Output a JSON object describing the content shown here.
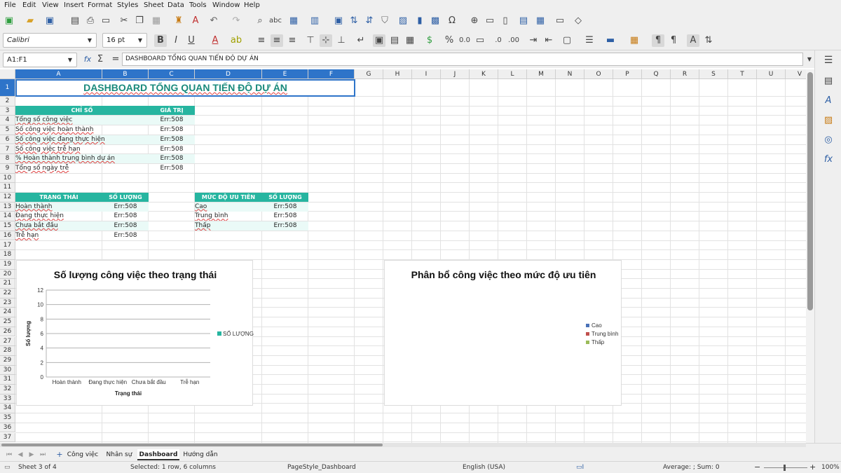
{
  "menu": [
    "File",
    "Edit",
    "View",
    "Insert",
    "Format",
    "Styles",
    "Sheet",
    "Data",
    "Tools",
    "Window",
    "Help"
  ],
  "toolbar": {
    "font_name": "Calibri",
    "font_size": "16 pt"
  },
  "formula_bar": {
    "name_box": "A1:F1",
    "content": "DASHBOARD TỔNG QUAN TIẾN ĐỘ DỰ ÁN"
  },
  "columns": [
    "A",
    "B",
    "C",
    "D",
    "E",
    "F",
    "G",
    "H",
    "I",
    "J",
    "K",
    "L",
    "M",
    "N",
    "O",
    "P",
    "Q",
    "R",
    "S",
    "T",
    "U",
    "V"
  ],
  "rows": [
    "1",
    "2",
    "3",
    "4",
    "5",
    "6",
    "7",
    "8",
    "9",
    "10",
    "11",
    "12",
    "13",
    "14",
    "15",
    "16",
    "17",
    "18",
    "19",
    "20",
    "21",
    "22",
    "23",
    "24",
    "25",
    "26",
    "27",
    "28",
    "29",
    "30",
    "31",
    "32",
    "33",
    "34",
    "35",
    "36",
    "37"
  ],
  "sheet": {
    "title": "DASHBOARD TỔNG QUAN TIẾN ĐỘ DỰ ÁN",
    "kpi_header": {
      "label": "CHỈ SỐ",
      "value": "GIÁ TRỊ"
    },
    "kpis": [
      {
        "label": "Tổng số công việc",
        "value": "Err:508"
      },
      {
        "label": "Số công việc hoàn thành",
        "value": "Err:508"
      },
      {
        "label": "Số công việc đang thực hiện",
        "value": "Err:508"
      },
      {
        "label": "Số công việc trễ hạn",
        "value": "Err:508"
      },
      {
        "label": "% Hoàn thành trung bình dự án",
        "value": "Err:508"
      },
      {
        "label": "Tổng số ngày trễ",
        "value": "Err:508"
      }
    ],
    "status_header": {
      "label": "TRẠNG THÁI",
      "value": "SỐ LƯỢNG"
    },
    "status_rows": [
      {
        "label": "Hoàn thành",
        "value": "Err:508"
      },
      {
        "label": "Đang thực hiện",
        "value": "Err:508"
      },
      {
        "label": "Chưa bắt đầu",
        "value": "Err:508"
      },
      {
        "label": "Trễ hạn",
        "value": "Err:508"
      }
    ],
    "priority_header": {
      "label": "MỨC ĐỘ ƯU TIÊN",
      "value": "SỐ LƯỢNG"
    },
    "priority_rows": [
      {
        "label": "Cao",
        "value": "Err:508"
      },
      {
        "label": "Trung bình",
        "value": "Err:508"
      },
      {
        "label": "Thấp",
        "value": "Err:508"
      }
    ]
  },
  "chart_data": [
    {
      "type": "bar",
      "title": "Số lượng công việc theo trạng thái",
      "categories": [
        "Hoàn thành",
        "Đang thực hiện",
        "Chưa bắt đầu",
        "Trễ hạn"
      ],
      "series": [
        {
          "name": "SỐ LƯỢNG",
          "values": [
            0,
            0,
            0,
            0
          ]
        }
      ],
      "xlabel": "Trạng thái",
      "ylabel": "Số lượng",
      "ylim": [
        0,
        12
      ],
      "yticks": [
        "0",
        "2",
        "4",
        "6",
        "8",
        "10",
        "12"
      ],
      "grid": true,
      "legend": "right",
      "color": "#26b5a0"
    },
    {
      "type": "pie",
      "title": "Phân bổ công việc theo mức độ ưu tiên",
      "categories": [
        "Cao",
        "Trung bình",
        "Thấp"
      ],
      "values": [
        0,
        0,
        0
      ],
      "legend": "right",
      "colors": [
        "#4a72b8",
        "#c0504d",
        "#9bbb59"
      ]
    }
  ],
  "tabs": [
    {
      "label": "Công việc",
      "active": false
    },
    {
      "label": "Nhân sự",
      "active": false
    },
    {
      "label": "Dashboard",
      "active": true
    },
    {
      "label": "Hướng dẫn",
      "active": false
    }
  ],
  "status": {
    "sheet": "Sheet 3 of 4",
    "selection": "Selected: 1 row, 6 columns",
    "page_style": "PageStyle_Dashboard",
    "language": "English (USA)",
    "summary": "Average: ; Sum: 0",
    "zoom": "100%"
  }
}
